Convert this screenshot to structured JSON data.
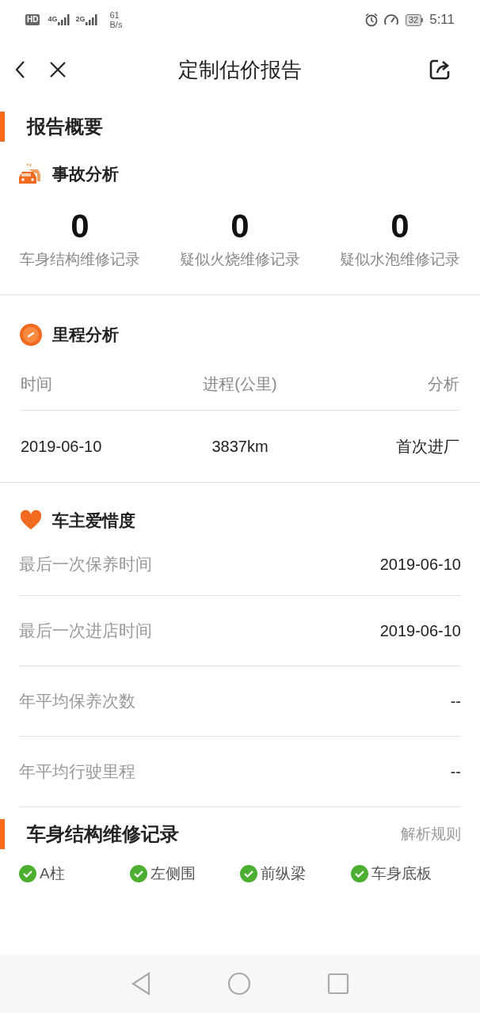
{
  "status_bar": {
    "hd": "HD",
    "sim1": "4G",
    "sim2": "2G",
    "speed_value": "61",
    "speed_unit": "B/s",
    "battery": "32",
    "time": "5:11"
  },
  "nav": {
    "title": "定制估价报告"
  },
  "summary": {
    "title": "报告概要"
  },
  "accident": {
    "title": "事故分析",
    "stats": [
      {
        "value": "0",
        "label": "车身结构维修记录"
      },
      {
        "value": "0",
        "label": "疑似火烧维修记录"
      },
      {
        "value": "0",
        "label": "疑似水泡维修记录"
      }
    ]
  },
  "mileage": {
    "title": "里程分析",
    "columns": [
      "时间",
      "进程(公里)",
      "分析"
    ],
    "rows": [
      [
        "2019-06-10",
        "3837km",
        "首次进厂"
      ]
    ]
  },
  "care": {
    "title": "车主爱惜度",
    "rows": [
      {
        "label": "最后一次保养时间",
        "value": "2019-06-10"
      },
      {
        "label": "最后一次进店时间",
        "value": "2019-06-10"
      },
      {
        "label": "年平均保养次数",
        "value": "--"
      },
      {
        "label": "年平均行驶里程",
        "value": "--"
      }
    ]
  },
  "structure": {
    "title": "车身结构维修记录",
    "link": "解析规则",
    "items": [
      {
        "label": "A柱",
        "checked": true
      },
      {
        "label": "左侧围",
        "checked": true
      },
      {
        "label": "前纵梁",
        "checked": true
      },
      {
        "label": "车身底板",
        "checked": true
      }
    ]
  }
}
